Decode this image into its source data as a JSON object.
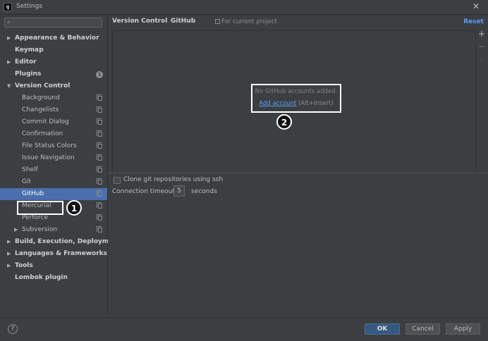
{
  "window": {
    "title": "Settings",
    "app_icon_text": "IJ",
    "close_symbol": "✕"
  },
  "search": {
    "placeholder": "",
    "value": "",
    "icon": "search-icon"
  },
  "tree": [
    {
      "label": "Appearance & Behavior",
      "bold": true,
      "arrow": "right"
    },
    {
      "label": "Keymap",
      "bold": true
    },
    {
      "label": "Editor",
      "bold": true,
      "arrow": "right"
    },
    {
      "label": "Plugins",
      "bold": true,
      "badge": "1"
    },
    {
      "label": "Version Control",
      "bold": true,
      "arrow": "down"
    },
    {
      "label": "Background"
    },
    {
      "label": "Changelists"
    },
    {
      "label": "Commit Dialog"
    },
    {
      "label": "Confirmation"
    },
    {
      "label": "File Status Colors"
    },
    {
      "label": "Issue Navigation"
    },
    {
      "label": "Shelf"
    },
    {
      "label": "Git"
    },
    {
      "label": "GitHub",
      "selected": true
    },
    {
      "label": "Mercurial"
    },
    {
      "label": "Perforce"
    },
    {
      "label": "Subversion",
      "arrow": "right"
    },
    {
      "label": "Build, Execution, Deployment",
      "bold": true,
      "arrow": "right"
    },
    {
      "label": "Languages & Frameworks",
      "bold": true,
      "arrow": "right"
    },
    {
      "label": "Tools",
      "bold": true,
      "arrow": "right"
    },
    {
      "label": "Lombok plugin",
      "bold": true
    }
  ],
  "callouts": [
    "1",
    "2"
  ],
  "header": {
    "breadcrumb_parent": "Version Control",
    "breadcrumb_sep": "›",
    "breadcrumb_current": "GitHub",
    "scope_label": "For current project",
    "reset_label": "Reset"
  },
  "toolbar": {
    "add": "+",
    "remove": "−",
    "check": "✓"
  },
  "accounts": {
    "empty_text": "No GitHub accounts added.",
    "add_link": "Add account",
    "shortcut": "(Alt+Insert)"
  },
  "options": {
    "clone_ssh_label": "Clone git repositories using ssh",
    "clone_ssh_checked": false,
    "timeout_label": "Connection timeout:",
    "timeout_value": "5",
    "timeout_unit": "seconds"
  },
  "footer": {
    "help": "?",
    "ok": "OK",
    "cancel": "Cancel",
    "apply": "Apply"
  },
  "colors": {
    "background": "#3c3f41",
    "selection": "#4b6eaf",
    "link": "#589df6",
    "ok_button": "#365880"
  }
}
